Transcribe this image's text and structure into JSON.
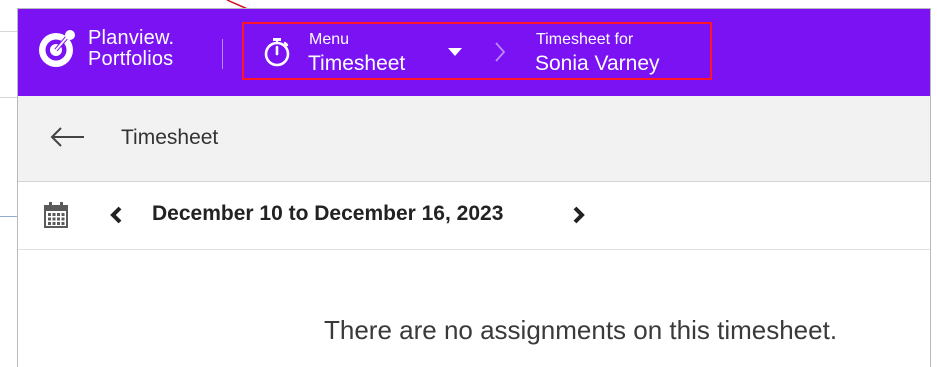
{
  "brand": {
    "name_line1": "Planview.",
    "name_line2": "Portfolios"
  },
  "header": {
    "menu_label": "Menu",
    "menu_value": "Timesheet",
    "timesheet_for_label": "Timesheet for",
    "timesheet_for_value": "Sonia Varney"
  },
  "subheader": {
    "title": "Timesheet"
  },
  "date_nav": {
    "range": "December 10 to December 16, 2023"
  },
  "content": {
    "empty_message": "There are no assignments on this timesheet."
  },
  "colors": {
    "header_bg": "#7a12f4",
    "highlight_border": "#ff1428",
    "subheader_bg": "#f2f2f2"
  },
  "icons": {
    "logo": "planview-logo-icon",
    "timer": "stopwatch-icon",
    "dropdown": "caret-down-icon",
    "separator": "chevron-right-icon",
    "back": "arrow-left-icon",
    "calendar": "calendar-icon",
    "prev": "chevron-left-icon",
    "next": "chevron-right-icon"
  }
}
